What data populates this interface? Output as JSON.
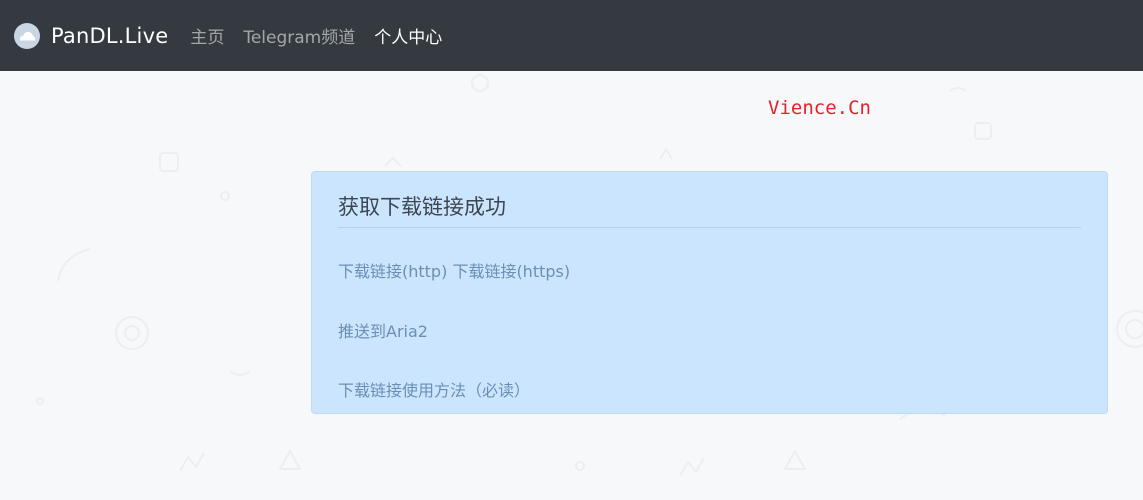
{
  "navbar": {
    "brand": "PanDL.Live",
    "links": [
      {
        "label": "主页",
        "active": false
      },
      {
        "label": "Telegram频道",
        "active": false
      },
      {
        "label": "个人中心",
        "active": true
      }
    ]
  },
  "watermark": "Vience.Cn",
  "alert": {
    "heading": "获取下载链接成功",
    "link_http": "下载链接(http)",
    "link_https": "下载链接(https)",
    "push_aria2": "推送到Aria2",
    "usage": "下载链接使用方法（必读）"
  },
  "colors": {
    "navbar_bg": "#343a40",
    "alert_bg": "#cce5ff",
    "link": "#6b8fb3",
    "watermark": "#e8202a"
  }
}
